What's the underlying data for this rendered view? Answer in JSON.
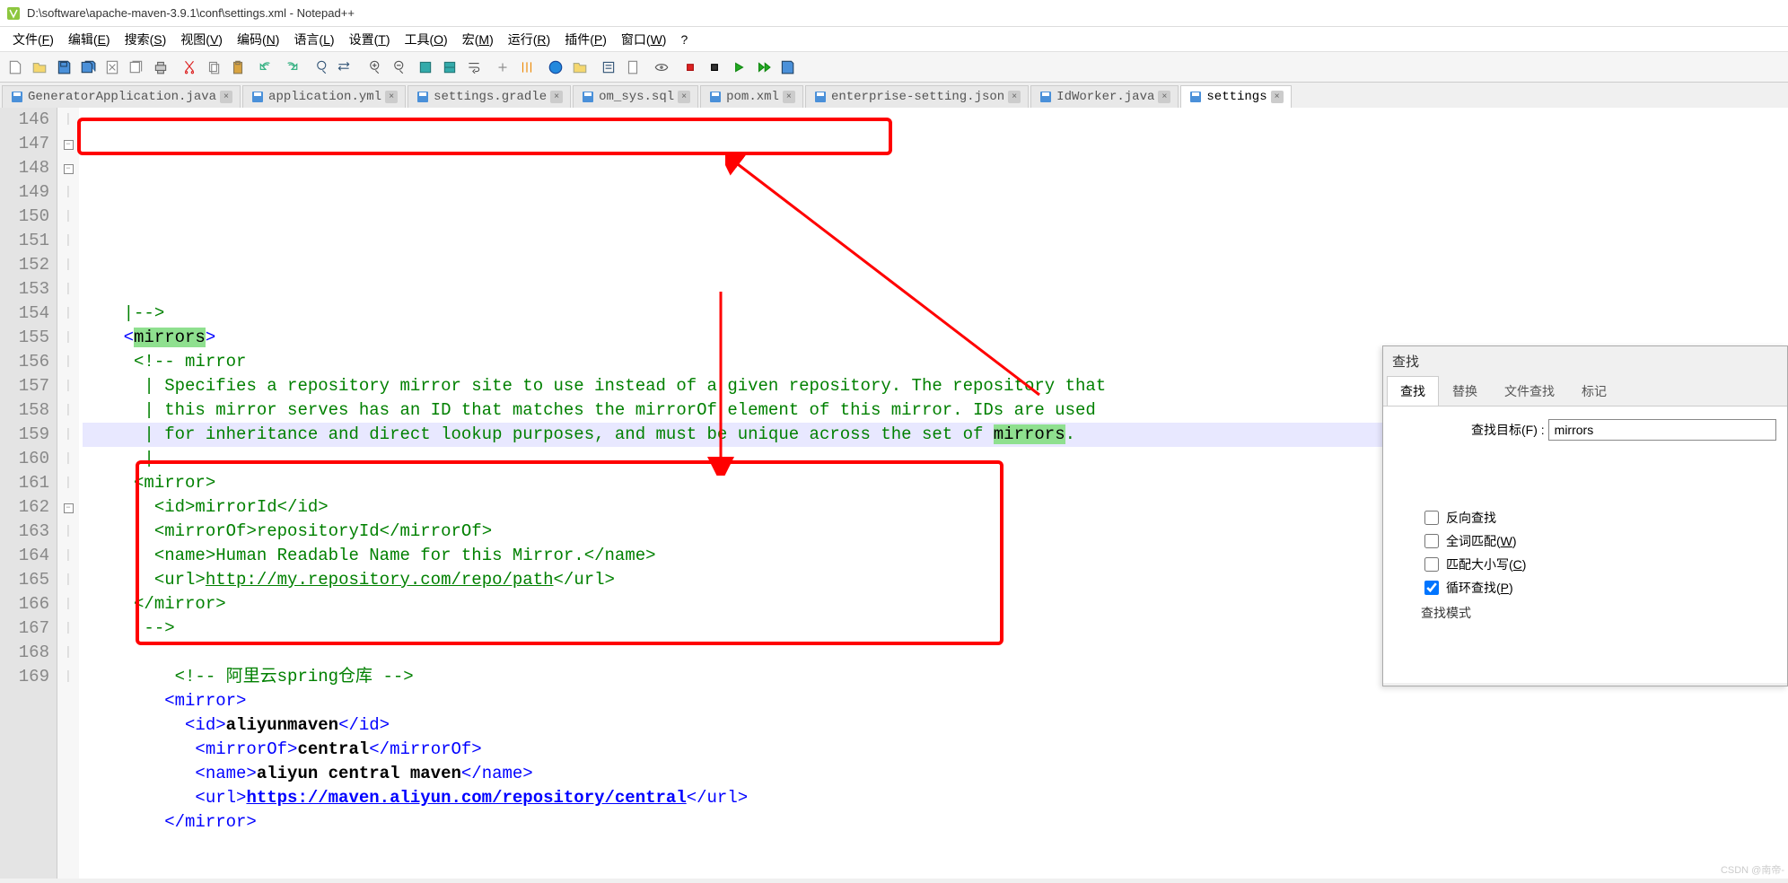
{
  "title": "D:\\software\\apache-maven-3.9.1\\conf\\settings.xml - Notepad++",
  "menus": [
    "文件(F)",
    "编辑(E)",
    "搜索(S)",
    "视图(V)",
    "编码(N)",
    "语言(L)",
    "设置(T)",
    "工具(O)",
    "宏(M)",
    "运行(R)",
    "插件(P)",
    "窗口(W)",
    "?"
  ],
  "tabs": [
    {
      "label": "GeneratorApplication.java"
    },
    {
      "label": "application.yml"
    },
    {
      "label": "settings.gradle"
    },
    {
      "label": "om_sys.sql"
    },
    {
      "label": "pom.xml"
    },
    {
      "label": "enterprise-setting.json"
    },
    {
      "label": "IdWorker.java"
    },
    {
      "label": "settings"
    }
  ],
  "active_tab": 7,
  "line_start": 146,
  "line_end": 169,
  "current_line": 151,
  "highlight_word": "mirrors",
  "code_lines": [
    {
      "n": 146,
      "indent": "    ",
      "html": "<span class='cmt'>|--&gt;</span>"
    },
    {
      "n": 147,
      "indent": "    ",
      "fold": "-",
      "html": "<span class='tag'>&lt;</span><span class='hl'>mirrors</span><span class='tag'>&gt;</span>"
    },
    {
      "n": 148,
      "indent": "     ",
      "fold": "-",
      "html": "<span class='cmt'>&lt;!-- mirror</span>"
    },
    {
      "n": 149,
      "indent": "      ",
      "html": "<span class='cmt'>| Specifies a repository mirror site to use instead of a given repository. The repository that</span>"
    },
    {
      "n": 150,
      "indent": "      ",
      "html": "<span class='cmt'>| this mirror serves has an ID that matches the mirrorOf element of this mirror. IDs are used</span>"
    },
    {
      "n": 151,
      "indent": "      ",
      "cur": true,
      "html": "<span class='cmt'>| for inheritance and direct lookup purposes, and must be unique across the set of </span><span class='hl'>mirrors</span><span class='cmt'>.</span>"
    },
    {
      "n": 152,
      "indent": "      ",
      "html": "<span class='cmt'>|</span>"
    },
    {
      "n": 153,
      "indent": "     ",
      "html": "<span class='cmt'>&lt;mirror&gt;</span>"
    },
    {
      "n": 154,
      "indent": "       ",
      "html": "<span class='cmt'>&lt;id&gt;mirrorId&lt;/id&gt;</span>"
    },
    {
      "n": 155,
      "indent": "       ",
      "html": "<span class='cmt'>&lt;mirrorOf&gt;repositoryId&lt;/mirrorOf&gt;</span>"
    },
    {
      "n": 156,
      "indent": "       ",
      "html": "<span class='cmt'>&lt;name&gt;Human Readable Name for this Mirror.&lt;/name&gt;</span>"
    },
    {
      "n": 157,
      "indent": "       ",
      "html": "<span class='cmt'>&lt;url&gt;<span style='text-decoration:underline'>http://my.repository.com/repo/path</span>&lt;/url&gt;</span>"
    },
    {
      "n": 158,
      "indent": "     ",
      "html": "<span class='cmt'>&lt;/mirror&gt;</span>"
    },
    {
      "n": 159,
      "indent": "      ",
      "html": "<span class='cmt'>--&gt;</span>"
    },
    {
      "n": 160,
      "indent": "",
      "html": ""
    },
    {
      "n": 161,
      "indent": "         ",
      "html": "<span class='cmt'>&lt;!-- 阿里云spring仓库 --&gt;</span>"
    },
    {
      "n": 162,
      "indent": "        ",
      "fold": "-",
      "html": "<span class='tag'>&lt;mirror&gt;</span>"
    },
    {
      "n": 163,
      "indent": "          ",
      "html": "<span class='tag'>&lt;id&gt;</span><span class='txt'>aliyunmaven</span><span class='tag'>&lt;/id&gt;</span>"
    },
    {
      "n": 164,
      "indent": "           ",
      "html": "<span class='tag'>&lt;mirrorOf&gt;</span><span class='txt'>central</span><span class='tag'>&lt;/mirrorOf&gt;</span>"
    },
    {
      "n": 165,
      "indent": "           ",
      "html": "<span class='tag'>&lt;name&gt;</span><span class='txt'>aliyun central maven</span><span class='tag'>&lt;/name&gt;</span>"
    },
    {
      "n": 166,
      "indent": "           ",
      "html": "<span class='tag'>&lt;url&gt;</span><span class='link'>https://maven.aliyun.com/repository/central</span><span class='tag'>&lt;/url&gt;</span>"
    },
    {
      "n": 167,
      "indent": "        ",
      "html": "<span class='tag'>&lt;/mirror&gt;</span>"
    },
    {
      "n": 168,
      "indent": "",
      "html": ""
    },
    {
      "n": 169,
      "indent": "",
      "html": ""
    }
  ],
  "find": {
    "title": "查找",
    "tabs": [
      "查找",
      "替换",
      "文件查找",
      "标记"
    ],
    "active_tab": 0,
    "target_label": "查找目标(F) :",
    "target_value": "mirrors",
    "checks": [
      {
        "label": "反向查找",
        "checked": false
      },
      {
        "label": "全词匹配(W)",
        "checked": false
      },
      {
        "label": "匹配大小写(C)",
        "checked": false
      },
      {
        "label": "循环查找(P)",
        "checked": true
      }
    ],
    "mode_label": "查找模式"
  },
  "watermark": "CSDN @南帝-"
}
